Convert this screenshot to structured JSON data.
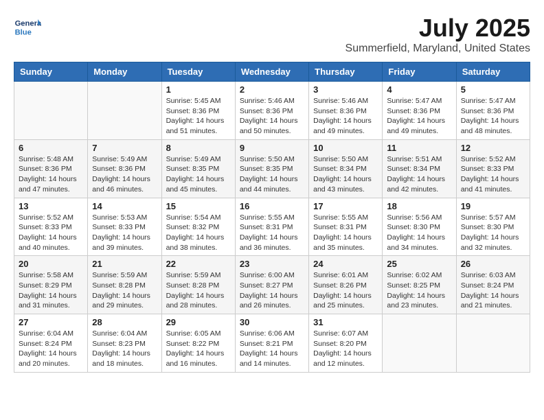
{
  "header": {
    "logo_general": "General",
    "logo_blue": "Blue",
    "month_title": "July 2025",
    "subtitle": "Summerfield, Maryland, United States"
  },
  "days_of_week": [
    "Sunday",
    "Monday",
    "Tuesday",
    "Wednesday",
    "Thursday",
    "Friday",
    "Saturday"
  ],
  "weeks": [
    [
      {
        "day": "",
        "info": ""
      },
      {
        "day": "",
        "info": ""
      },
      {
        "day": "1",
        "info": "Sunrise: 5:45 AM\nSunset: 8:36 PM\nDaylight: 14 hours and 51 minutes."
      },
      {
        "day": "2",
        "info": "Sunrise: 5:46 AM\nSunset: 8:36 PM\nDaylight: 14 hours and 50 minutes."
      },
      {
        "day": "3",
        "info": "Sunrise: 5:46 AM\nSunset: 8:36 PM\nDaylight: 14 hours and 49 minutes."
      },
      {
        "day": "4",
        "info": "Sunrise: 5:47 AM\nSunset: 8:36 PM\nDaylight: 14 hours and 49 minutes."
      },
      {
        "day": "5",
        "info": "Sunrise: 5:47 AM\nSunset: 8:36 PM\nDaylight: 14 hours and 48 minutes."
      }
    ],
    [
      {
        "day": "6",
        "info": "Sunrise: 5:48 AM\nSunset: 8:36 PM\nDaylight: 14 hours and 47 minutes."
      },
      {
        "day": "7",
        "info": "Sunrise: 5:49 AM\nSunset: 8:36 PM\nDaylight: 14 hours and 46 minutes."
      },
      {
        "day": "8",
        "info": "Sunrise: 5:49 AM\nSunset: 8:35 PM\nDaylight: 14 hours and 45 minutes."
      },
      {
        "day": "9",
        "info": "Sunrise: 5:50 AM\nSunset: 8:35 PM\nDaylight: 14 hours and 44 minutes."
      },
      {
        "day": "10",
        "info": "Sunrise: 5:50 AM\nSunset: 8:34 PM\nDaylight: 14 hours and 43 minutes."
      },
      {
        "day": "11",
        "info": "Sunrise: 5:51 AM\nSunset: 8:34 PM\nDaylight: 14 hours and 42 minutes."
      },
      {
        "day": "12",
        "info": "Sunrise: 5:52 AM\nSunset: 8:33 PM\nDaylight: 14 hours and 41 minutes."
      }
    ],
    [
      {
        "day": "13",
        "info": "Sunrise: 5:52 AM\nSunset: 8:33 PM\nDaylight: 14 hours and 40 minutes."
      },
      {
        "day": "14",
        "info": "Sunrise: 5:53 AM\nSunset: 8:33 PM\nDaylight: 14 hours and 39 minutes."
      },
      {
        "day": "15",
        "info": "Sunrise: 5:54 AM\nSunset: 8:32 PM\nDaylight: 14 hours and 38 minutes."
      },
      {
        "day": "16",
        "info": "Sunrise: 5:55 AM\nSunset: 8:31 PM\nDaylight: 14 hours and 36 minutes."
      },
      {
        "day": "17",
        "info": "Sunrise: 5:55 AM\nSunset: 8:31 PM\nDaylight: 14 hours and 35 minutes."
      },
      {
        "day": "18",
        "info": "Sunrise: 5:56 AM\nSunset: 8:30 PM\nDaylight: 14 hours and 34 minutes."
      },
      {
        "day": "19",
        "info": "Sunrise: 5:57 AM\nSunset: 8:30 PM\nDaylight: 14 hours and 32 minutes."
      }
    ],
    [
      {
        "day": "20",
        "info": "Sunrise: 5:58 AM\nSunset: 8:29 PM\nDaylight: 14 hours and 31 minutes."
      },
      {
        "day": "21",
        "info": "Sunrise: 5:59 AM\nSunset: 8:28 PM\nDaylight: 14 hours and 29 minutes."
      },
      {
        "day": "22",
        "info": "Sunrise: 5:59 AM\nSunset: 8:28 PM\nDaylight: 14 hours and 28 minutes."
      },
      {
        "day": "23",
        "info": "Sunrise: 6:00 AM\nSunset: 8:27 PM\nDaylight: 14 hours and 26 minutes."
      },
      {
        "day": "24",
        "info": "Sunrise: 6:01 AM\nSunset: 8:26 PM\nDaylight: 14 hours and 25 minutes."
      },
      {
        "day": "25",
        "info": "Sunrise: 6:02 AM\nSunset: 8:25 PM\nDaylight: 14 hours and 23 minutes."
      },
      {
        "day": "26",
        "info": "Sunrise: 6:03 AM\nSunset: 8:24 PM\nDaylight: 14 hours and 21 minutes."
      }
    ],
    [
      {
        "day": "27",
        "info": "Sunrise: 6:04 AM\nSunset: 8:24 PM\nDaylight: 14 hours and 20 minutes."
      },
      {
        "day": "28",
        "info": "Sunrise: 6:04 AM\nSunset: 8:23 PM\nDaylight: 14 hours and 18 minutes."
      },
      {
        "day": "29",
        "info": "Sunrise: 6:05 AM\nSunset: 8:22 PM\nDaylight: 14 hours and 16 minutes."
      },
      {
        "day": "30",
        "info": "Sunrise: 6:06 AM\nSunset: 8:21 PM\nDaylight: 14 hours and 14 minutes."
      },
      {
        "day": "31",
        "info": "Sunrise: 6:07 AM\nSunset: 8:20 PM\nDaylight: 14 hours and 12 minutes."
      },
      {
        "day": "",
        "info": ""
      },
      {
        "day": "",
        "info": ""
      }
    ]
  ]
}
